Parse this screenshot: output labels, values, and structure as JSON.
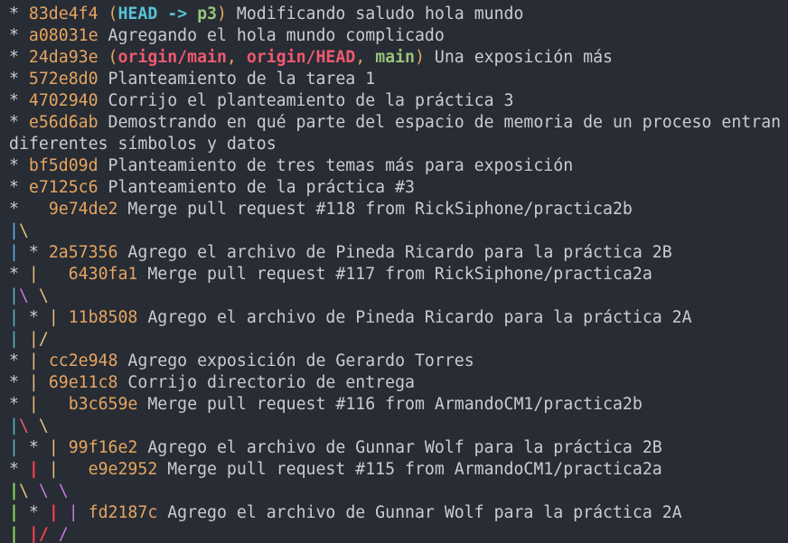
{
  "terminal": {
    "lines": [
      {
        "graph": [
          {
            "t": "* ",
            "c": "default"
          }
        ],
        "hash": "83de4f4",
        "refs": [
          {
            "name": "HEAD",
            "kind": "local"
          },
          {
            "name": "p3",
            "kind": "branch"
          }
        ],
        "refs_style": "arrow",
        "message": "Modificando saludo hola mundo"
      },
      {
        "graph": [
          {
            "t": "* ",
            "c": "default"
          }
        ],
        "hash": "a08031e",
        "message": "Agregando el hola mundo complicado"
      },
      {
        "graph": [
          {
            "t": "* ",
            "c": "default"
          }
        ],
        "hash": "24da93e",
        "refs": [
          {
            "name": "origin/main",
            "kind": "remote"
          },
          {
            "name": "origin/HEAD",
            "kind": "remote"
          },
          {
            "name": "main",
            "kind": "branch"
          }
        ],
        "refs_style": "list",
        "message": "Una exposición más"
      },
      {
        "graph": [
          {
            "t": "* ",
            "c": "default"
          }
        ],
        "hash": "572e8d0",
        "message": "Planteamiento de la tarea 1"
      },
      {
        "graph": [
          {
            "t": "* ",
            "c": "default"
          }
        ],
        "hash": "4702940",
        "message": "Corrijo el planteamiento de la práctica 3"
      },
      {
        "graph": [
          {
            "t": "* ",
            "c": "default"
          }
        ],
        "hash": "e56d6ab",
        "message": "Demostrando en qué parte del espacio de memoria de un proceso entran diferentes símbolos y datos",
        "wrap": true
      },
      {
        "graph": [
          {
            "t": "* ",
            "c": "default"
          }
        ],
        "hash": "bf5d09d",
        "message": "Planteamiento de tres temas más para exposición"
      },
      {
        "graph": [
          {
            "t": "* ",
            "c": "default"
          }
        ],
        "hash": "e7125c6",
        "message": "Planteamiento de la práctica #3"
      },
      {
        "graph": [
          {
            "t": "*   ",
            "c": "default"
          }
        ],
        "hash": "9e74de2",
        "message": "Merge pull request #118 from RickSiphone/practica2b"
      },
      {
        "graph": [
          {
            "t": "|",
            "c": "blue"
          },
          {
            "t": "\\",
            "c": "yellow"
          }
        ]
      },
      {
        "graph": [
          {
            "t": "| ",
            "c": "blue"
          },
          {
            "t": "* ",
            "c": "default"
          }
        ],
        "hash": "2a57356",
        "message": "Agrego el archivo de Pineda Ricardo para la práctica 2B"
      },
      {
        "graph": [
          {
            "t": "* ",
            "c": "default"
          },
          {
            "t": "|",
            "c": "yellow"
          },
          {
            "t": "   ",
            "c": "default"
          }
        ],
        "hash": "6430fa1",
        "message": "Merge pull request #117 from RickSiphone/practica2a"
      },
      {
        "graph": [
          {
            "t": "|",
            "c": "cyan"
          },
          {
            "t": "\\",
            "c": "magenta"
          },
          {
            "t": " ",
            "c": "default"
          },
          {
            "t": "\\",
            "c": "yellow"
          }
        ]
      },
      {
        "graph": [
          {
            "t": "| ",
            "c": "cyan"
          },
          {
            "t": "* ",
            "c": "default"
          },
          {
            "t": "| ",
            "c": "yellow"
          }
        ],
        "hash": "11b8508",
        "message": "Agrego el archivo de Pineda Ricardo para la práctica 2A"
      },
      {
        "graph": [
          {
            "t": "| ",
            "c": "cyan"
          },
          {
            "t": "|/",
            "c": "yellow"
          }
        ]
      },
      {
        "graph": [
          {
            "t": "* ",
            "c": "default"
          },
          {
            "t": "| ",
            "c": "yellow"
          }
        ],
        "hash": "cc2e948",
        "message": "Agrego exposición de Gerardo Torres"
      },
      {
        "graph": [
          {
            "t": "* ",
            "c": "default"
          },
          {
            "t": "| ",
            "c": "yellow"
          }
        ],
        "hash": "69e11c8",
        "message": "Corrijo directorio de entrega"
      },
      {
        "graph": [
          {
            "t": "* ",
            "c": "default"
          },
          {
            "t": "|",
            "c": "yellow"
          },
          {
            "t": "   ",
            "c": "default"
          }
        ],
        "hash": "b3c659e",
        "message": "Merge pull request #116 from ArmandoCM1/practica2b"
      },
      {
        "graph": [
          {
            "t": "|",
            "c": "cyan"
          },
          {
            "t": "\\",
            "c": "red"
          },
          {
            "t": " ",
            "c": "default"
          },
          {
            "t": "\\",
            "c": "yellow"
          }
        ]
      },
      {
        "graph": [
          {
            "t": "| ",
            "c": "cyan"
          },
          {
            "t": "* ",
            "c": "default"
          },
          {
            "t": "| ",
            "c": "yellow"
          }
        ],
        "hash": "99f16e2",
        "message": "Agrego el archivo de Gunnar Wolf para la práctica 2B"
      },
      {
        "graph": [
          {
            "t": "* ",
            "c": "default"
          },
          {
            "t": "| ",
            "c": "bred"
          },
          {
            "t": "|",
            "c": "yellow"
          },
          {
            "t": "   ",
            "c": "default"
          }
        ],
        "hash": "e9e2952",
        "message": "Merge pull request #115 from ArmandoCM1/practica2a"
      },
      {
        "graph": [
          {
            "t": "|",
            "c": "bgreen"
          },
          {
            "t": "\\",
            "c": "yellow"
          },
          {
            "t": " ",
            "c": "default"
          },
          {
            "t": "\\",
            "c": "magenta"
          },
          {
            "t": " ",
            "c": "default"
          },
          {
            "t": "\\",
            "c": "magenta"
          }
        ]
      },
      {
        "graph": [
          {
            "t": "| ",
            "c": "bgreen"
          },
          {
            "t": "* ",
            "c": "default"
          },
          {
            "t": "| ",
            "c": "bred"
          },
          {
            "t": "| ",
            "c": "magenta"
          }
        ],
        "hash": "fd2187c",
        "message": "Agrego el archivo de Gunnar Wolf para la práctica 2A"
      },
      {
        "graph": [
          {
            "t": "| ",
            "c": "bgreen"
          },
          {
            "t": "|/",
            "c": "bred"
          },
          {
            "t": " ",
            "c": "default"
          },
          {
            "t": "/",
            "c": "magenta"
          }
        ]
      }
    ]
  }
}
